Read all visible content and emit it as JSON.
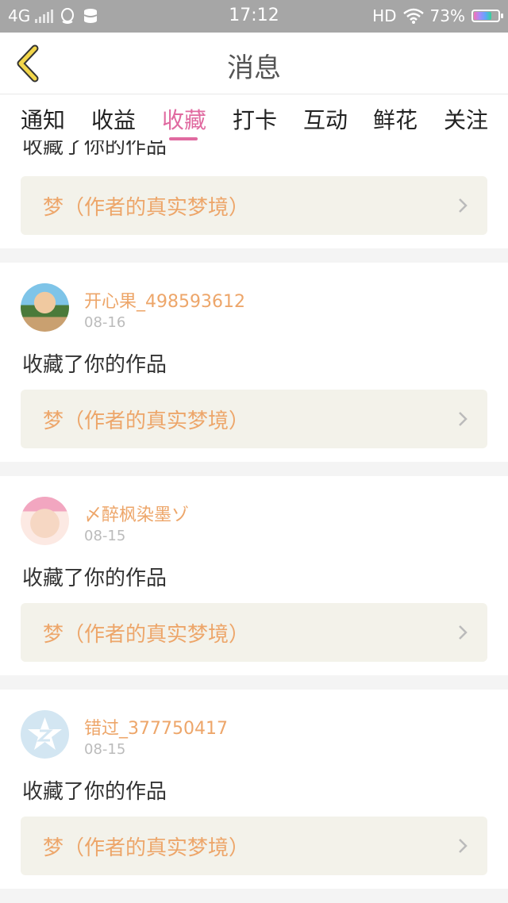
{
  "status_bar": {
    "network": "4G",
    "time": "17:12",
    "hd": "HD",
    "battery": "73%"
  },
  "header": {
    "title": "消息"
  },
  "tabs": [
    {
      "label": "通知"
    },
    {
      "label": "收益"
    },
    {
      "label": "收藏"
    },
    {
      "label": "打卡"
    },
    {
      "label": "互动"
    },
    {
      "label": "鲜花"
    },
    {
      "label": "关注"
    }
  ],
  "active_tab": "收藏",
  "partial_card": {
    "message": "收藏了你的作品",
    "work_title": "梦（作者的真实梦境）"
  },
  "cards": [
    {
      "username": "开心果_498593612",
      "date": "08-16",
      "message": "收藏了你的作品",
      "work_title": "梦（作者的真实梦境）"
    },
    {
      "username": "〆醉枫染墨ゾ",
      "date": "08-15",
      "message": "收藏了你的作品",
      "work_title": "梦（作者的真实梦境）"
    },
    {
      "username": "错过_377750417",
      "date": "08-15",
      "message": "收藏了你的作品",
      "work_title": "梦（作者的真实梦境）"
    }
  ],
  "colors": {
    "accent_pink": "#e06aa0",
    "username_orange": "#eda66a",
    "back_arrow_yellow": "#f2d64a"
  }
}
